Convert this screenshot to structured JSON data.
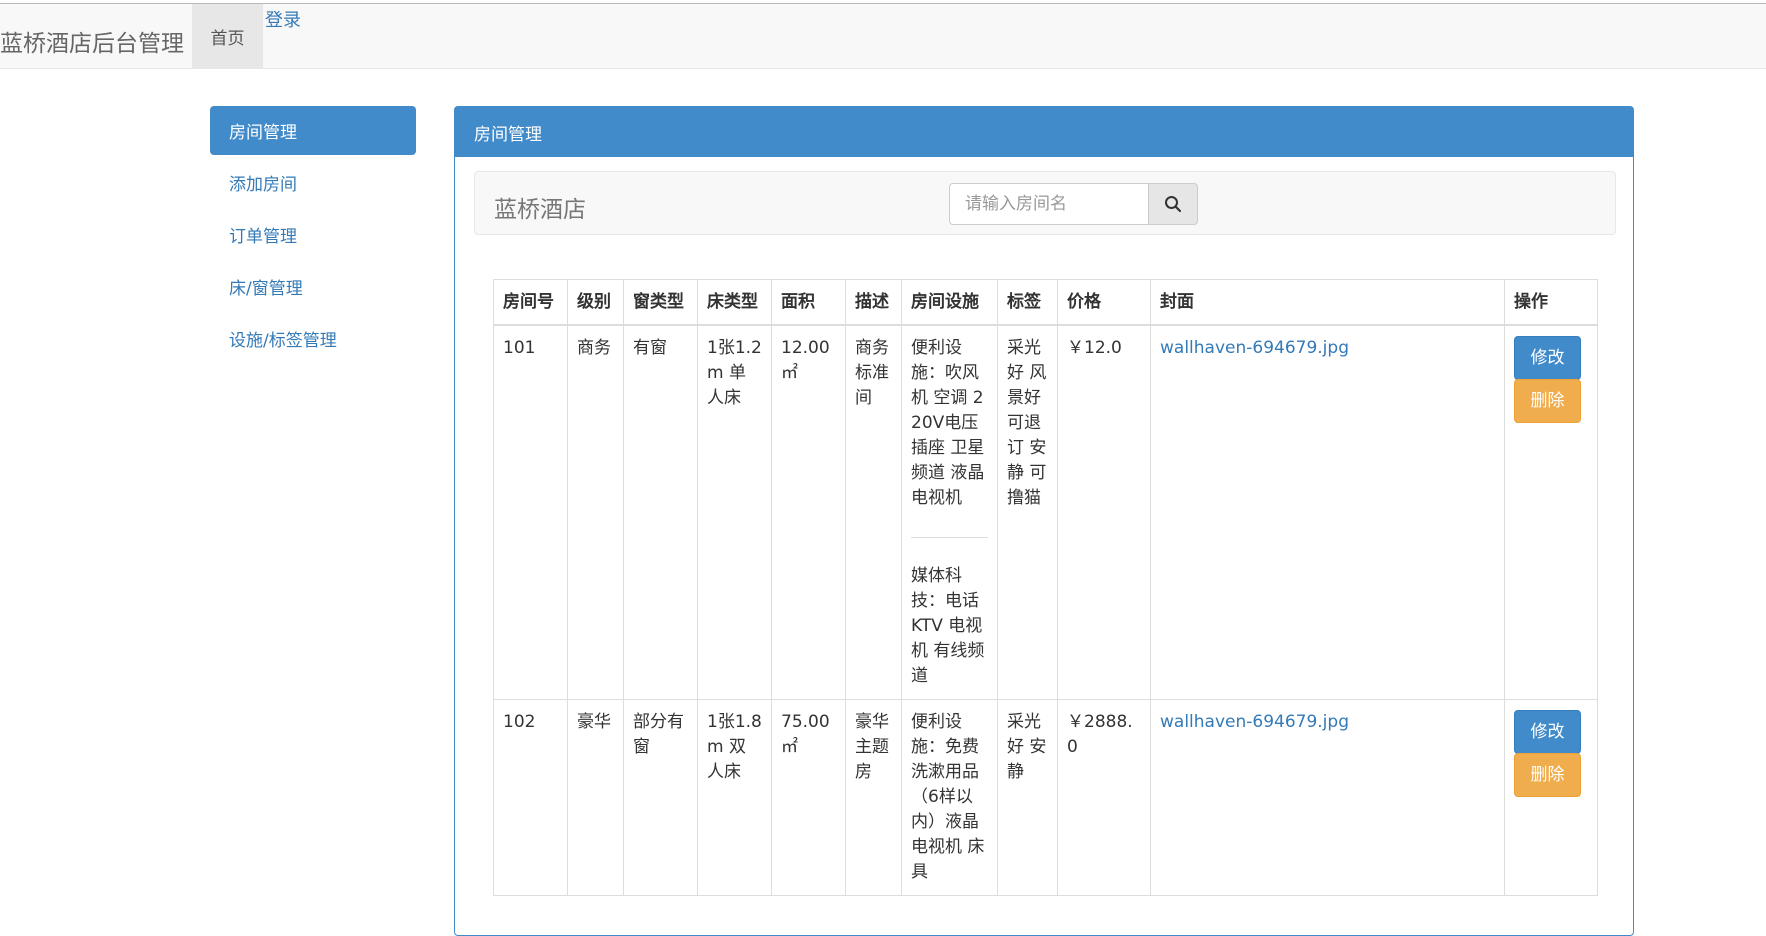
{
  "navbar": {
    "brand": "蓝桥酒店后台管理",
    "home_label": "首页",
    "login_label": "登录"
  },
  "sidebar": {
    "items": [
      {
        "label": "房间管理",
        "active": true
      },
      {
        "label": "添加房间"
      },
      {
        "label": "订单管理"
      },
      {
        "label": "床/窗管理"
      },
      {
        "label": "设施/标签管理"
      }
    ]
  },
  "panel": {
    "title": "房间管理",
    "hotel_name": "蓝桥酒店",
    "search": {
      "placeholder": "请输入房间名"
    }
  },
  "table": {
    "headers": [
      "房间号",
      "级别",
      "窗类型",
      "床类型",
      "面积",
      "描述",
      "房间设施",
      "标签",
      "价格",
      "封面",
      "操作"
    ],
    "rows": [
      {
        "room_no": "101",
        "level": "商务",
        "window": "有窗",
        "bed": "1张1.2m 单人床",
        "area": "12.00 ㎡",
        "desc": "商务标准间",
        "facilities": [
          "便利设施：吹风机 空调 220V电压插座 卫星频道 液晶电视机",
          "媒体科技：电话 KTV 电视机 有线频道"
        ],
        "tags": "采光好 风景好 可退订 安静 可撸猫",
        "price": "￥12.0",
        "cover": "wallhaven-694679.jpg",
        "edit_label": "修改",
        "delete_label": "删除"
      },
      {
        "room_no": "102",
        "level": "豪华",
        "window": "部分有窗",
        "bed": "1张1.8m 双人床",
        "area": "75.00 ㎡",
        "desc": "豪华主题房",
        "facilities": [
          "便利设施：免费洗漱用品（6样以内）液晶电视机 床具"
        ],
        "tags": "采光好 安静",
        "price": "￥2888.0",
        "cover": "wallhaven-694679.jpg",
        "edit_label": "修改",
        "delete_label": "删除"
      }
    ]
  },
  "colors": {
    "primary": "#428bca",
    "warning": "#f0ad4e",
    "link": "#337ab7"
  }
}
